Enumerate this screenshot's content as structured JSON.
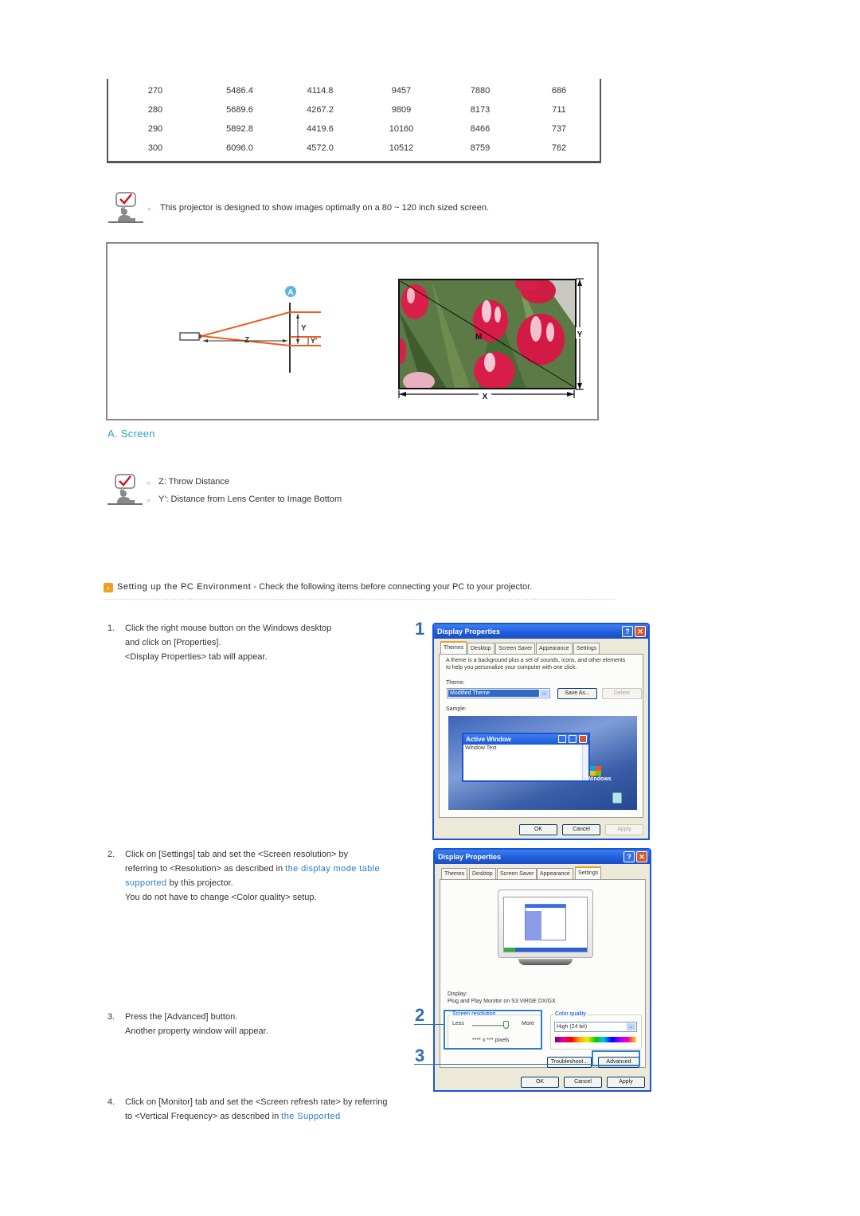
{
  "table": {
    "rows": [
      [
        "270",
        "5486.4",
        "4114.8",
        "9457",
        "7880",
        "686"
      ],
      [
        "280",
        "5689.6",
        "4267.2",
        "9809",
        "8173",
        "711"
      ],
      [
        "290",
        "5892.8",
        "4419.6",
        "10160",
        "8466",
        "737"
      ],
      [
        "300",
        "6096.0",
        "4572.0",
        "10512",
        "8759",
        "762"
      ]
    ]
  },
  "note1": {
    "icon": "checkmark-person-icon",
    "text": "This projector is designed to show images optimally on a 80 ~ 120 inch sized screen."
  },
  "diagram": {
    "marker_a": "A",
    "label_y": "Y",
    "label_z": "Z",
    "label_y_prime": "Y'",
    "screen_label_m": "M",
    "screen_label_x": "X",
    "screen_label_y": "Y",
    "accent_color": "#f05a1e"
  },
  "section_label": "A. Screen",
  "note2": {
    "icon": "checkmark-person-icon",
    "items": [
      "Z: Throw Distance",
      "Y': Distance from Lens Center to Image Bottom"
    ]
  },
  "pc_section": {
    "icon": "orange-arrow-icon",
    "title": "Setting up the PC Environment",
    "subtitle": " - Check the following items before connecting your PC to your projector."
  },
  "steps": [
    {
      "num": "1.",
      "lines": [
        "Click the right mouse button on the Windows desktop",
        "and click on [Properties].",
        "<Display Properties> tab will appear."
      ]
    },
    {
      "num": "2.",
      "line1": "Click on [Settings] tab and set the <Screen resolution> by",
      "line2_pre": "referring to <Resolution> as described in ",
      "line2_link": "the display mode table",
      "line3_link": "supported",
      "line3_post": " by this projector.",
      "line4": "You do not have to change <Color quality> setup."
    },
    {
      "num": "3.",
      "lines": [
        "Press the [Advanced] button.",
        "Another property window will appear."
      ]
    },
    {
      "num": "4.",
      "line1": "Click on [Monitor] tab and set the <Screen refresh rate> by referring",
      "line2_pre": "to <Vertical Frequency> as described in ",
      "line2_link": "the Supported"
    }
  ],
  "dialog1": {
    "callout": "1",
    "title": "Display Properties",
    "help": "?",
    "close": "✕",
    "tabs": [
      "Themes",
      "Desktop",
      "Screen Saver",
      "Appearance",
      "Settings"
    ],
    "active_tab": "Themes",
    "description_line1": "A theme is a background plus a set of sounds, icons, and other elements",
    "description_line2": "to help you personalize your computer with one click.",
    "theme_label": "Theme:",
    "theme_value": "Modified Theme",
    "save_as": "Save As...",
    "delete": "Delete",
    "sample_label": "Sample:",
    "sample_window_title": "Active Window",
    "sample_window_text": "Window Text",
    "windows_logo_text": "Windows",
    "ok": "OK",
    "cancel": "Cancel",
    "apply": "Apply"
  },
  "dialog2": {
    "callout2": "2",
    "callout3": "3",
    "title": "Display Properties",
    "help": "?",
    "close": "✕",
    "tabs": [
      "Themes",
      "Desktop",
      "Screen Saver",
      "Appearance",
      "Settings"
    ],
    "active_tab": "Settings",
    "display_label": "Display:",
    "display_value": "Plug and Play Monitor on S3 ViRGE DX/GX",
    "resolution_group": "Screen resolution",
    "less": "Less",
    "more": "More",
    "pixels": "**** x *** pixels",
    "color_group": "Color quality",
    "color_value": "High (24 bit)",
    "troubleshoot": "Troubleshoot...",
    "advanced": "Advanced",
    "ok": "OK",
    "cancel": "Cancel",
    "apply": "Apply"
  }
}
